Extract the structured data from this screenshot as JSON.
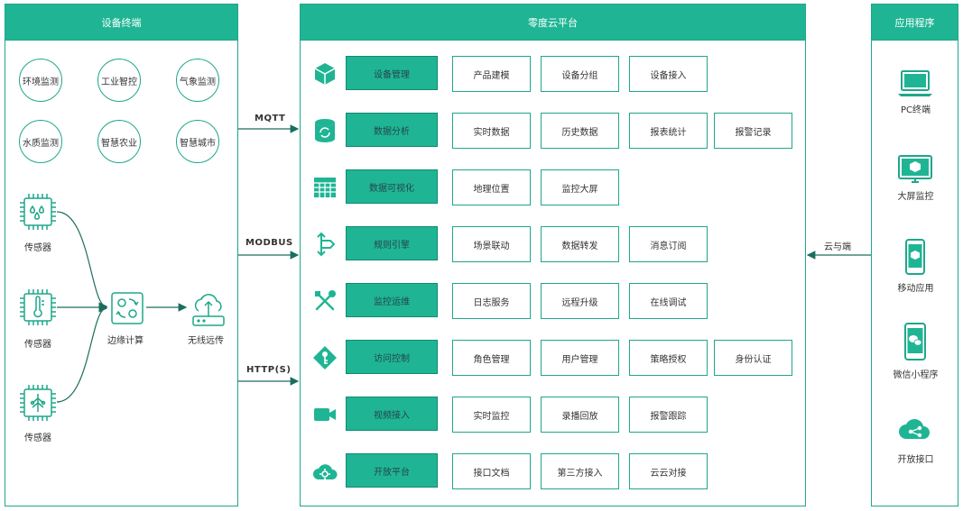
{
  "left_panel": {
    "title": "设备终端",
    "scenarios": [
      "环境监测",
      "工业智控",
      "气象监测",
      "水质监测",
      "智慧农业",
      "智慧城市"
    ],
    "sensors": [
      "传感器",
      "传感器",
      "传感器"
    ],
    "edge_label": "边缘计算",
    "wireless_label": "无线远传"
  },
  "protocols": {
    "mqtt": "MQTT",
    "modbus": "MODBUS",
    "http": "HTTP(S)",
    "cloud_edge": "云与端"
  },
  "center_panel": {
    "title": "零度云平台",
    "rows": [
      {
        "icon": "box-icon",
        "main": "设备管理",
        "subs": [
          "产品建模",
          "设备分组",
          "设备接入"
        ]
      },
      {
        "icon": "database-refresh-icon",
        "main": "数据分析",
        "subs": [
          "实时数据",
          "历史数据",
          "报表统计",
          "报警记录"
        ]
      },
      {
        "icon": "table-grid-icon",
        "main": "数据可视化",
        "subs": [
          "地理位置",
          "监控大屏"
        ]
      },
      {
        "icon": "rule-engine-icon",
        "main": "规则引擎",
        "subs": [
          "场景联动",
          "数据转发",
          "消息订阅"
        ]
      },
      {
        "icon": "tools-icon",
        "main": "监控运维",
        "subs": [
          "日志服务",
          "远程升级",
          "在线调试"
        ]
      },
      {
        "icon": "key-icon",
        "main": "访问控制",
        "subs": [
          "角色管理",
          "用户管理",
          "策略授权",
          "身份认证"
        ]
      },
      {
        "icon": "video-camera-icon",
        "main": "视频接入",
        "subs": [
          "实时监控",
          "录播回放",
          "报警跟踪"
        ]
      },
      {
        "icon": "cloud-gear-icon",
        "main": "开放平台",
        "subs": [
          "接口文档",
          "第三方接入",
          "云云对接"
        ]
      }
    ]
  },
  "right_panel": {
    "title": "应用程序",
    "apps": [
      {
        "icon": "laptop-icon",
        "label": "PC终端"
      },
      {
        "icon": "monitor-cube-icon",
        "label": "大屏监控"
      },
      {
        "icon": "mobile-cube-icon",
        "label": "移动应用"
      },
      {
        "icon": "wechat-phone-icon",
        "label": "微信小程序"
      },
      {
        "icon": "cloud-share-icon",
        "label": "开放接口"
      }
    ]
  },
  "colors": {
    "accent": "#1fb594",
    "border": "#1fa78a",
    "dark": "#0f8a6f"
  }
}
